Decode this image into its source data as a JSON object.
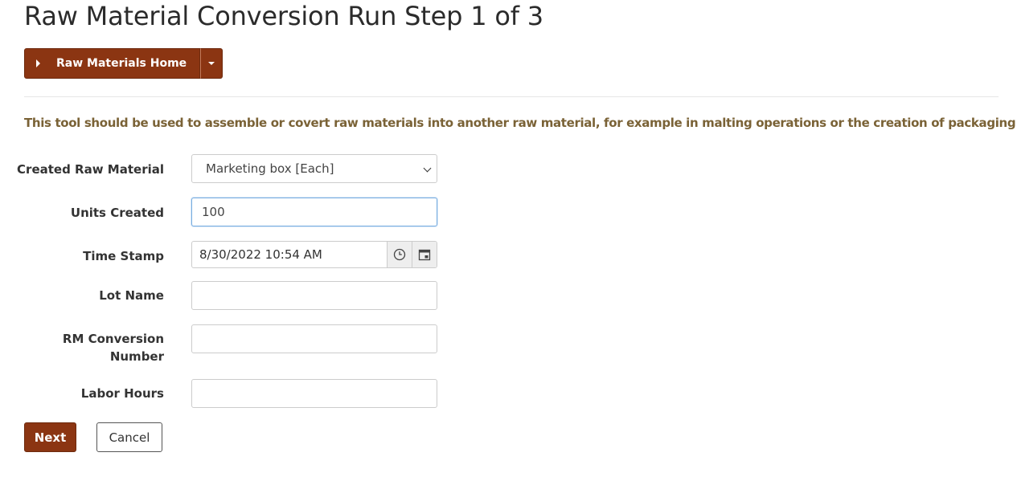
{
  "page": {
    "title": "Raw Material Conversion Run Step 1 of 3"
  },
  "toolbar": {
    "home_label": "Raw Materials Home"
  },
  "intro_text": "This tool should be used to assemble or covert raw materials into another raw material, for example in malting operations or the creation of packaging kits.",
  "form": {
    "created_raw_material": {
      "label": "Created Raw Material",
      "selected": "Marketing box [Each]"
    },
    "units_created": {
      "label": "Units Created",
      "value": "100"
    },
    "time_stamp": {
      "label": "Time Stamp",
      "value": "8/30/2022 10:54 AM"
    },
    "lot_name": {
      "label": "Lot Name",
      "value": ""
    },
    "rm_conversion_number": {
      "label_line1": "RM Conversion",
      "label_line2": "Number",
      "value": ""
    },
    "labor_hours": {
      "label": "Labor Hours",
      "value": ""
    }
  },
  "actions": {
    "next_label": "Next",
    "cancel_label": "Cancel"
  },
  "colors": {
    "primary": "#8b3512",
    "intro_text": "#7a6236",
    "focus_border": "#7aaee0"
  },
  "icons": {
    "home_button": "caret-right-icon",
    "dropdown_toggle": "caret-down-icon",
    "time_picker": "clock-icon",
    "date_picker": "calendar-icon",
    "select": "chevron-down-icon"
  }
}
